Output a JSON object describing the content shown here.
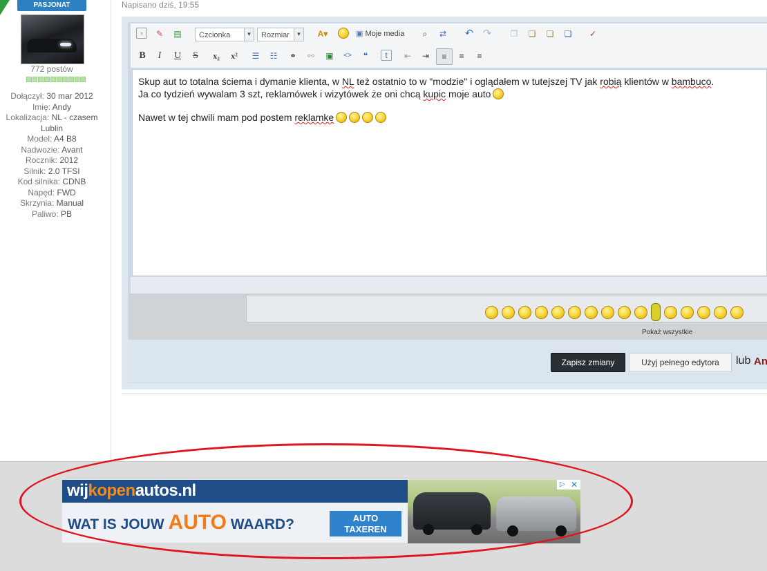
{
  "user_panel": {
    "rank": "PASJONAT",
    "posts": "772 postów",
    "fields": [
      {
        "label": "Dołączył:",
        "value": "30 mar 2012"
      },
      {
        "label": "Imię:",
        "value": "Andy"
      },
      {
        "label": "Lokalizacja:",
        "value": "NL - czasem Lublin"
      },
      {
        "label": "Model:",
        "value": "A4 B8"
      },
      {
        "label": "Nadwozie:",
        "value": "Avant"
      },
      {
        "label": "Rocznik:",
        "value": "2012"
      },
      {
        "label": "Silnik:",
        "value": "2.0 TFSI"
      },
      {
        "label": "Kod silnika:",
        "value": "CDNB"
      },
      {
        "label": "Napęd:",
        "value": "FWD"
      },
      {
        "label": "Skrzynia:",
        "value": "Manual"
      },
      {
        "label": "Paliwo:",
        "value": "PB"
      }
    ]
  },
  "post": {
    "date": "Napisano dziś, 19:55"
  },
  "toolbar": {
    "font_select": "Czcionka",
    "size_select": "Rozmiar",
    "media_label": "Moje media",
    "row1_icons": [
      "source-icon",
      "eraser-icon",
      "paste-plain-icon",
      "text-color-icon",
      "emoticon-icon",
      "media-icon",
      "find-icon",
      "replace-icon",
      "undo-icon",
      "redo-icon",
      "cut-icon",
      "copy-icon",
      "paste-icon",
      "paste-word-icon",
      "spellcheck-icon"
    ],
    "row2": [
      {
        "name": "bold-button",
        "glyph": "B"
      },
      {
        "name": "italic-button",
        "glyph": "I"
      },
      {
        "name": "underline-button",
        "glyph": "U"
      },
      {
        "name": "strike-button",
        "glyph": "S"
      },
      {
        "name": "subscript-button",
        "glyph": "x₂"
      },
      {
        "name": "superscript-button",
        "glyph": "x²"
      },
      {
        "name": "bullet-list-button",
        "glyph": "☰"
      },
      {
        "name": "number-list-button",
        "glyph": "☷"
      },
      {
        "name": "link-button",
        "glyph": "⚭"
      },
      {
        "name": "unlink-button",
        "glyph": "⚯"
      },
      {
        "name": "image-button",
        "glyph": "▣"
      },
      {
        "name": "code-button",
        "glyph": "<>"
      },
      {
        "name": "quote-button",
        "glyph": "❝"
      },
      {
        "name": "twitter-button",
        "glyph": "t"
      },
      {
        "name": "outdent-button",
        "glyph": "⇤"
      },
      {
        "name": "indent-button",
        "glyph": "⇥"
      },
      {
        "name": "align-left-button",
        "glyph": "≡"
      },
      {
        "name": "align-center-button",
        "glyph": "≡"
      },
      {
        "name": "align-right-button",
        "glyph": "≡"
      }
    ]
  },
  "editor": {
    "line1_a": "Skup aut to totalna ściema i dymanie klienta, w ",
    "line1_nl": "NL",
    "line1_b": " też ostatnio to w \"modzie\" i oglądałem w tutejszej TV jak ",
    "line1_robia": "robią",
    "line1_c": " klientów w ",
    "line1_bambuco": "bambuco",
    "line1_d": ".",
    "line2_a": "Ja co tydzień wywalam 3 szt, reklamówek i wizytówek że oni chcą ",
    "line2_kupic": "kupic",
    "line2_b": " moje auto",
    "line3_a": "Nawet w tej chwili mam pod postem ",
    "line3_reklamke": "reklamke"
  },
  "smileys": {
    "show_all": "Pokaż wszystkie",
    "icons": [
      "smile-emoticon-icon",
      "shocked-emoticon-icon",
      "wink-emoticon-icon",
      "laugh-emoticon-icon",
      "tongue-emoticon-icon",
      "grin-emoticon-icon",
      "biggrin-emoticon-icon",
      "sad-emoticon-icon",
      "happy-emoticon-icon",
      "facepalm-emoticon-icon",
      "banana-emoticon-icon",
      "unsure-emoticon-icon",
      "teeth-emoticon-icon",
      "angry-emoticon-icon",
      "crazy-emoticon-icon",
      "huh-emoticon-icon"
    ]
  },
  "actions": {
    "save": "Zapisz zmiany",
    "full_editor": "Użyj pełnego edytora",
    "lub": "lub",
    "cancel": "An"
  },
  "ad": {
    "brand_a": "wij",
    "brand_b": "kopen",
    "brand_c": "autos.nl",
    "question_a": "WAT IS JOUW ",
    "question_big": "AUTO",
    "question_b": " WAARD?",
    "cta_line1": "AUTO",
    "cta_line2": "TAXEREN",
    "info": "▷",
    "close": "✕"
  },
  "colors": {
    "annotation": "#e0141e",
    "rank_badge": "#2c7fc0",
    "ad_navy": "#1e4d87",
    "ad_orange": "#f38a1e"
  }
}
